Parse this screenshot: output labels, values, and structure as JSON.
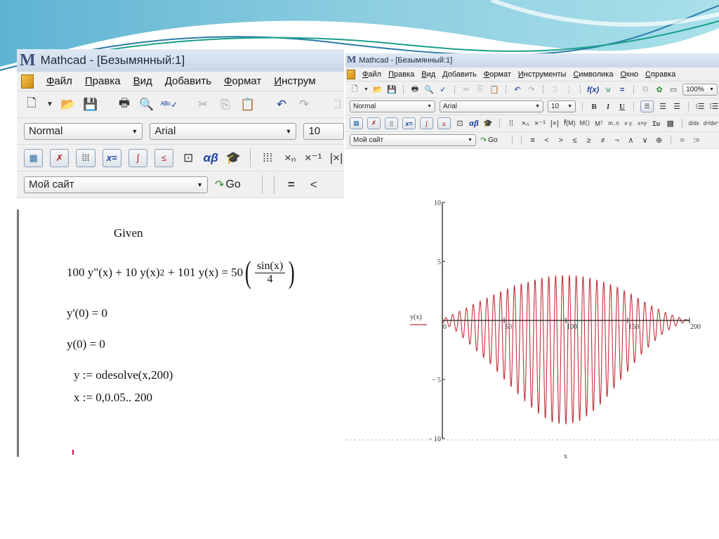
{
  "left_window": {
    "title": "Mathcad - [Безымянный:1]",
    "menu": [
      "Файл",
      "Правка",
      "Вид",
      "Добавить",
      "Формат",
      "Инструм"
    ],
    "format_bar": {
      "style": "Normal",
      "font": "Arial",
      "size": "10"
    },
    "resources_bar": {
      "site": "Мой сайт",
      "go_label": "Go"
    },
    "worksheet": {
      "given": "Given",
      "equation": {
        "lhs": "100 y\"(x) + 10 y(x)",
        "power": "2",
        "rest": "+ 101 y(x) = 50",
        "frac_num": "sin(x)",
        "frac_den": "4"
      },
      "condition1": "y'(0) = 0",
      "condition2": "y(0) = 0",
      "solve": "y := odesolve(x,200)",
      "range": "x := 0,0.05.. 200"
    }
  },
  "right_window": {
    "title": "Mathcad - [Безымянный:1]",
    "menu": [
      "Файл",
      "Правка",
      "Вид",
      "Добавить",
      "Формат",
      "Инструменты",
      "Символика",
      "Окно",
      "Справка"
    ],
    "zoom": "100%",
    "format_bar": {
      "style": "Normal",
      "font": "Arial",
      "size": "10",
      "bold": "B",
      "italic": "I",
      "underline": "U"
    },
    "resources_bar": {
      "site": "Мой сайт",
      "go_label": "Go"
    },
    "boolean_ops": [
      "=",
      "<",
      ">",
      "≤",
      "≥",
      "≠",
      "¬",
      "∧",
      "∨",
      "⊕"
    ],
    "eval_ops": [
      "=",
      ":="
    ]
  },
  "chart_data": {
    "type": "line",
    "title": "",
    "xlabel": "x",
    "ylabel": "y(x)",
    "xlim": [
      0,
      200
    ],
    "ylim": [
      -10,
      10
    ],
    "x_ticks": [
      "0",
      "50",
      "100",
      "150",
      "200"
    ],
    "y_ticks": [
      "10",
      "5",
      "-5",
      "-10"
    ],
    "grid": false,
    "legend": "left",
    "series": [
      {
        "name": "y(x)",
        "color": "#c0303a",
        "description": "oscillation of ~36 cycles over [0,200]; positive peaks rise to ~3.8 near x=100, negative troughs reach ~-8.8 near x=100, tapering toward 0 at both ends",
        "x": [
          0,
          10,
          20,
          30,
          40,
          50,
          60,
          70,
          80,
          90,
          100,
          110,
          120,
          130,
          140,
          150,
          160,
          170,
          180,
          190,
          200
        ],
        "upper_envelope": [
          0.1,
          0.6,
          1.1,
          1.6,
          2.1,
          2.6,
          3.0,
          3.3,
          3.6,
          3.8,
          3.85,
          3.8,
          3.6,
          3.3,
          2.9,
          2.4,
          1.8,
          1.2,
          0.7,
          0.3,
          0.0
        ],
        "lower_envelope": [
          -0.2,
          -0.8,
          -1.8,
          -2.8,
          -3.8,
          -5.0,
          -6.1,
          -7.2,
          -8.1,
          -8.7,
          -8.8,
          -8.6,
          -7.9,
          -6.9,
          -5.6,
          -4.3,
          -3.0,
          -1.9,
          -1.0,
          -0.4,
          0.0
        ],
        "cycles": 36
      }
    ]
  }
}
